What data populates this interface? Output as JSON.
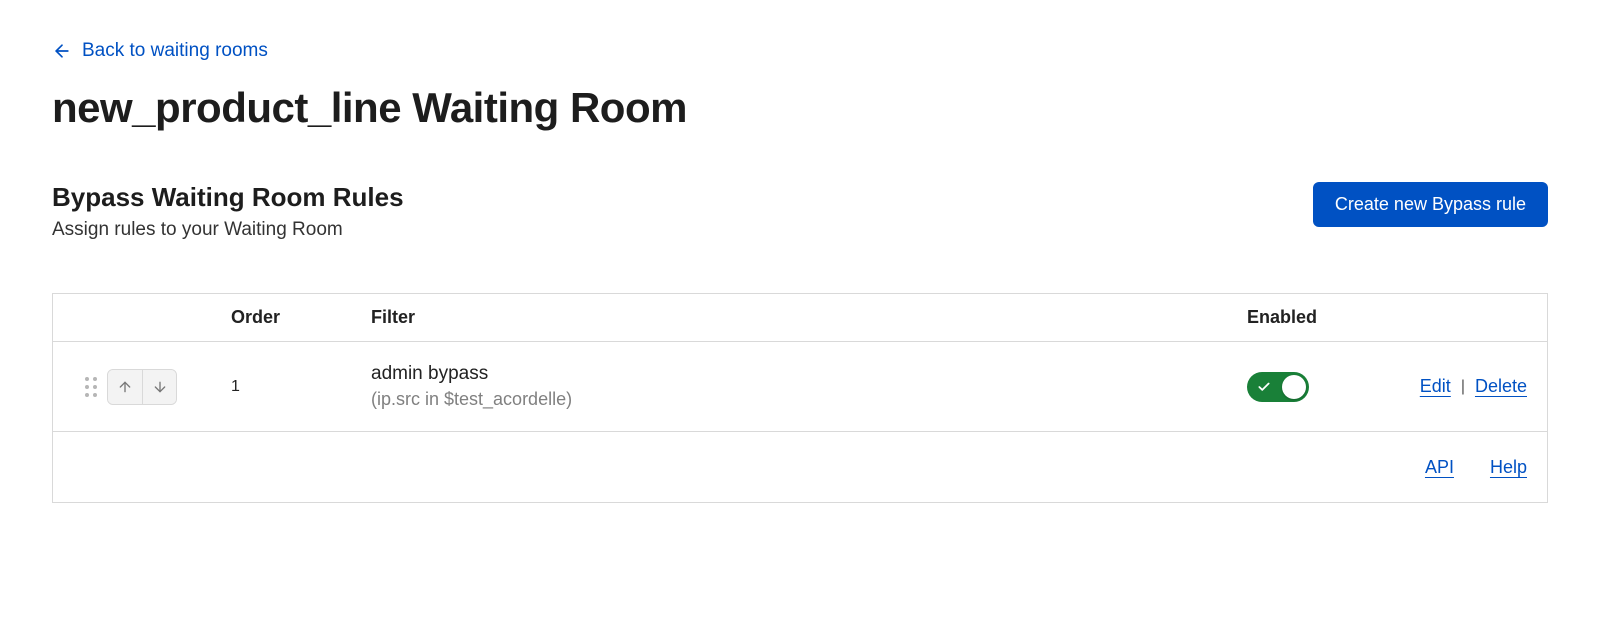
{
  "back_link_label": "Back to waiting rooms",
  "page_title": "new_product_line Waiting Room",
  "section": {
    "title": "Bypass Waiting Room Rules",
    "subtitle": "Assign rules to your Waiting Room",
    "create_button": "Create new Bypass rule"
  },
  "columns": {
    "order": "Order",
    "filter": "Filter",
    "enabled": "Enabled"
  },
  "rules": [
    {
      "order": "1",
      "name": "admin bypass",
      "expression": "(ip.src in $test_acordelle)",
      "enabled": true
    }
  ],
  "row_actions": {
    "edit": "Edit",
    "delete": "Delete"
  },
  "footer_links": {
    "api": "API",
    "help": "Help"
  }
}
